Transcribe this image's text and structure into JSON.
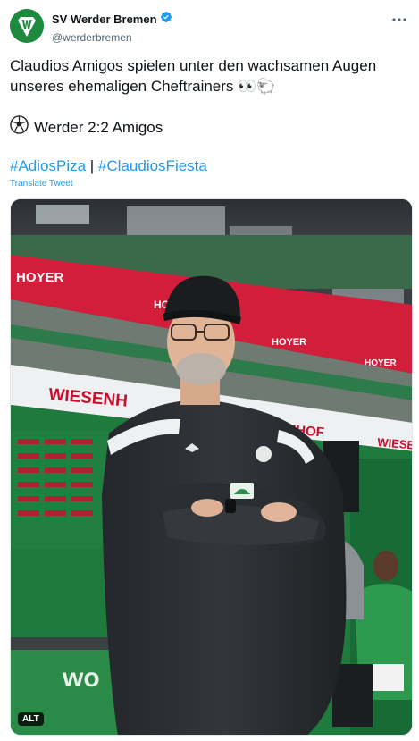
{
  "author": {
    "display_name": "SV Werder Bremen",
    "handle": "@werderbremen",
    "verified": true,
    "avatar_color": "#1d8a3e"
  },
  "tweet": {
    "text": "Claudios Amigos spielen unter den wachsamen Augen unseres ehemaligen Cheftrainers 👀🐑",
    "score_icon": "soccer-ball-icon",
    "score_text": "Werder 2:2 Amigos",
    "hashtags": [
      "#AdiosPiza",
      "#ClaudiosFiesta"
    ],
    "hashtag_separator": "|",
    "translate_label": "Translate Tweet"
  },
  "media": {
    "alt_label": "ALT",
    "banner_texts": {
      "sponsor_top_left": "HOYER",
      "sponsor_top_mid": "HOY",
      "sponsor_top_right": "HOYER",
      "sponsor_top_right2": "HOYER",
      "stand_main": "WIESENH",
      "stand_mid": "HHOF",
      "stand_right": "WIESE",
      "ground_banner": "wo"
    }
  },
  "colors": {
    "link": "#1d9bf0",
    "verified": "#1d9bf0",
    "werder_green": "#1d8a3e"
  }
}
